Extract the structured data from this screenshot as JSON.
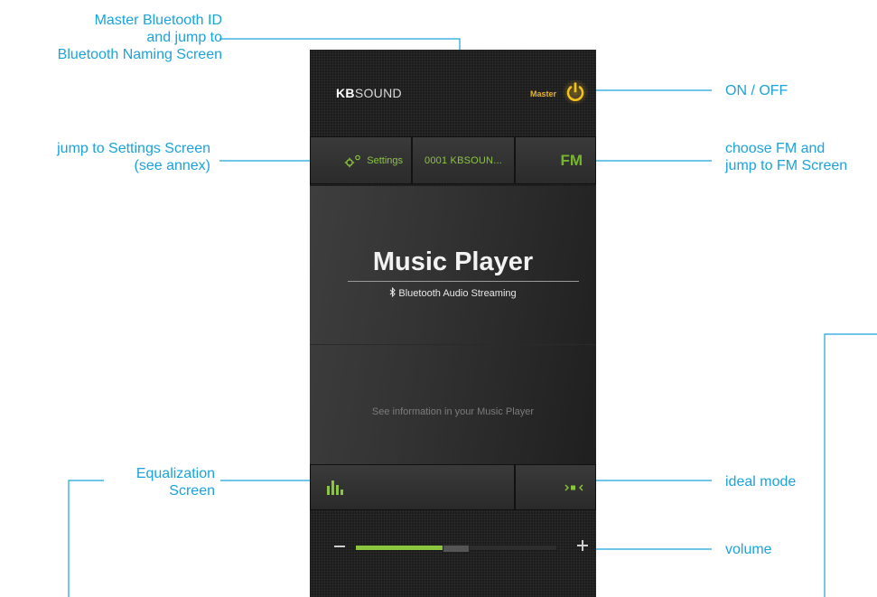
{
  "app": {
    "brand_bold": "KB",
    "brand_rest": "SOUND",
    "master_label": "Master"
  },
  "tabs": {
    "settings_label": "Settings",
    "bluetooth_id_label": "0001 KBSOUN...",
    "fm_label": "FM"
  },
  "main": {
    "title": "Music Player",
    "subtitle": "Bluetooth Audio Streaming",
    "info_text": "See information in your Music Player"
  },
  "volume": {
    "level": 0.45
  },
  "annotations": {
    "master_id": [
      "Master Bluetooth ID",
      "and jump to",
      "Bluetooth Naming Screen"
    ],
    "settings": [
      "jump to Settings Screen",
      "(see annex)"
    ],
    "on_off": [
      "ON / OFF"
    ],
    "fm": [
      "choose FM and",
      "jump to FM Screen"
    ],
    "equalization": [
      "Equalization",
      "Screen"
    ],
    "ideal_mode": [
      "ideal mode"
    ],
    "volume": [
      "volume"
    ]
  },
  "colors": {
    "accent_green": "#8bc63f",
    "power_yellow": "#e7b526",
    "annotation_blue": "#1aa3dc"
  },
  "icons": {
    "power": "power-icon",
    "settings": "gear-icon",
    "bluetooth": "bluetooth-icon",
    "equalizer": "equalizer-bars-icon",
    "ideal_mode": "ideal-mode-icon"
  }
}
